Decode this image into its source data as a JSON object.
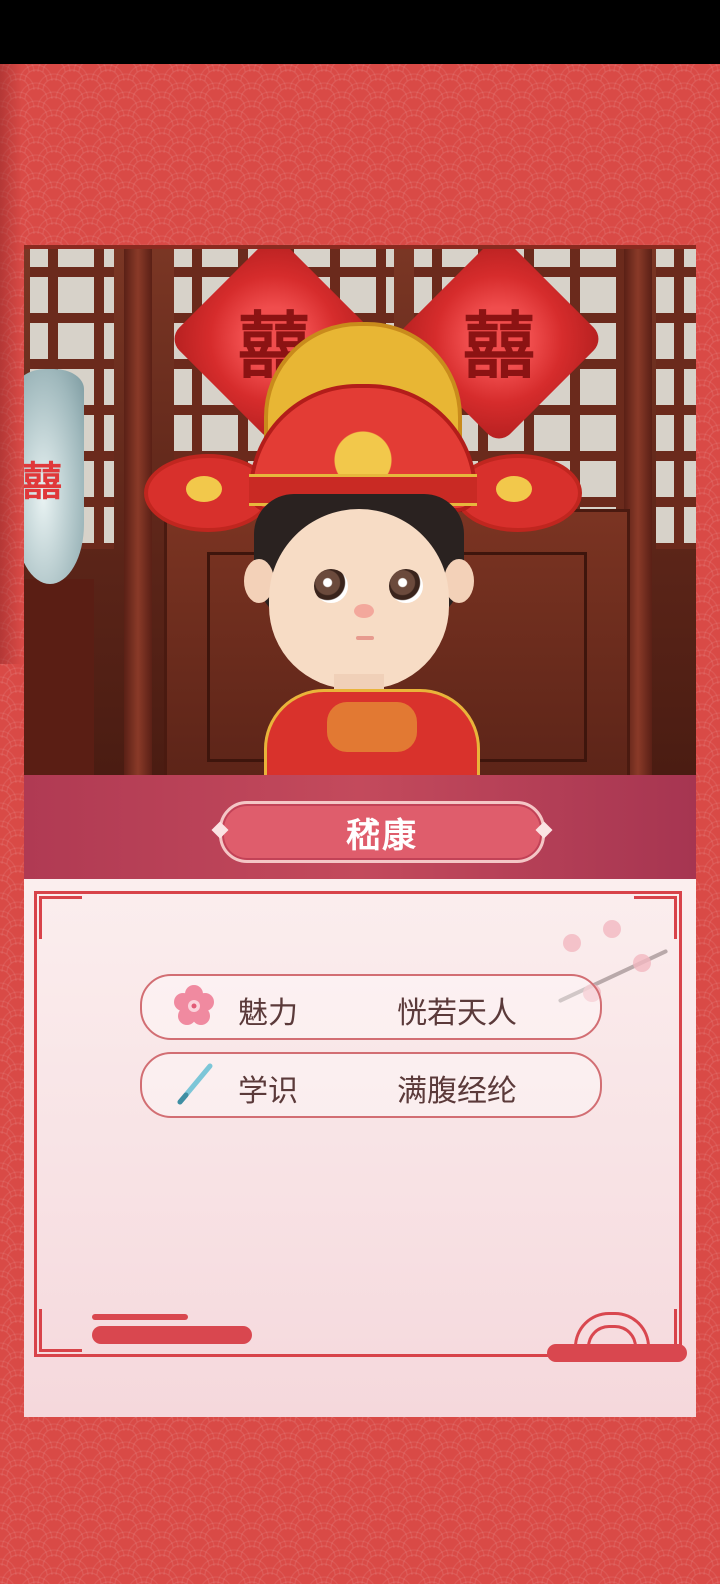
{
  "character": {
    "name": "嵇康"
  },
  "scene": {
    "decor_glyph": "囍"
  },
  "stats": [
    {
      "icon": "plum-blossom-icon",
      "label": "魅力",
      "value": "恍若天人"
    },
    {
      "icon": "brush-icon",
      "label": "学识",
      "value": "满腹经纶"
    }
  ],
  "colors": {
    "background": "#d94a46",
    "banner": "#b03a53",
    "name_plate": "#df5d6c",
    "panel": "#fbeeee",
    "frame": "#d8434a"
  }
}
